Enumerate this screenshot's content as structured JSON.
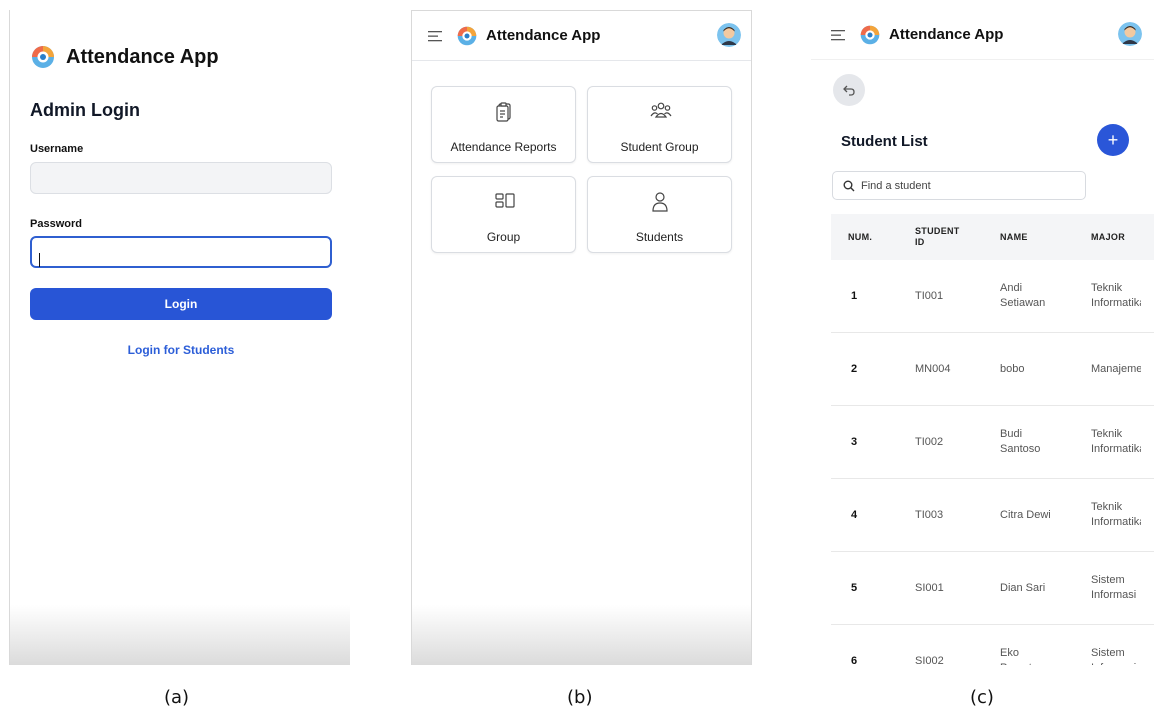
{
  "app_name": "Attendance App",
  "colors": {
    "primary": "#2855d6",
    "link": "#2c5ed8",
    "focus": "#2f5fd0"
  },
  "panel_a": {
    "title": "Admin Login",
    "username_label": "Username",
    "username_value": "",
    "password_label": "Password",
    "password_value": "",
    "login_button": "Login",
    "student_login_link": "Login for Students"
  },
  "panel_b": {
    "cards": [
      {
        "label": "Attendance Reports",
        "icon": "clipboard-icon"
      },
      {
        "label": "Student Group",
        "icon": "users-group-icon"
      },
      {
        "label": "Group",
        "icon": "layout-group-icon"
      },
      {
        "label": "Students",
        "icon": "user-icon"
      }
    ]
  },
  "panel_c": {
    "title": "Student List",
    "search_placeholder": "Find a student",
    "add_button": "+",
    "columns": {
      "num": "NUM.",
      "student_id": "STUDENT ID",
      "name": "NAME",
      "major": "MAJOR"
    },
    "rows": [
      {
        "num": "1",
        "id": "TI001",
        "name": "Andi Setiawan",
        "major": "Teknik Informatika"
      },
      {
        "num": "2",
        "id": "MN004",
        "name": "bobo",
        "major": "Manajemen"
      },
      {
        "num": "3",
        "id": "TI002",
        "name": "Budi Santoso",
        "major": "Teknik Informatika"
      },
      {
        "num": "4",
        "id": "TI003",
        "name": "Citra Dewi",
        "major": "Teknik Informatika"
      },
      {
        "num": "5",
        "id": "SI001",
        "name": "Dian Sari",
        "major": "Sistem Informasi"
      },
      {
        "num": "6",
        "id": "SI002",
        "name": "Eko Prasetyo",
        "major": "Sistem Informasi"
      }
    ]
  },
  "captions": [
    "(a)",
    "(b)",
    "(c)"
  ]
}
